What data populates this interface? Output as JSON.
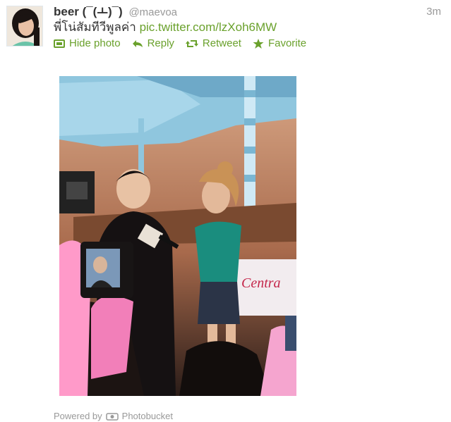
{
  "tweet": {
    "display_name": "beer (¯(ㅗ)¯)",
    "handle": "@maevoa",
    "time": "3m",
    "text": "พี่โน่สัมทีวีพูลค่า",
    "link": "pic.twitter.com/lzXoh6MW"
  },
  "actions": {
    "hide_photo": "Hide photo",
    "reply": "Reply",
    "retweet": "Retweet",
    "favorite": "Favorite"
  },
  "footer": {
    "powered_by": "Powered by",
    "provider": "Photobucket"
  },
  "photo": {
    "sign_text": "Centra"
  },
  "colors": {
    "accent": "#6aa12c",
    "muted": "#999999",
    "text": "#333333"
  }
}
